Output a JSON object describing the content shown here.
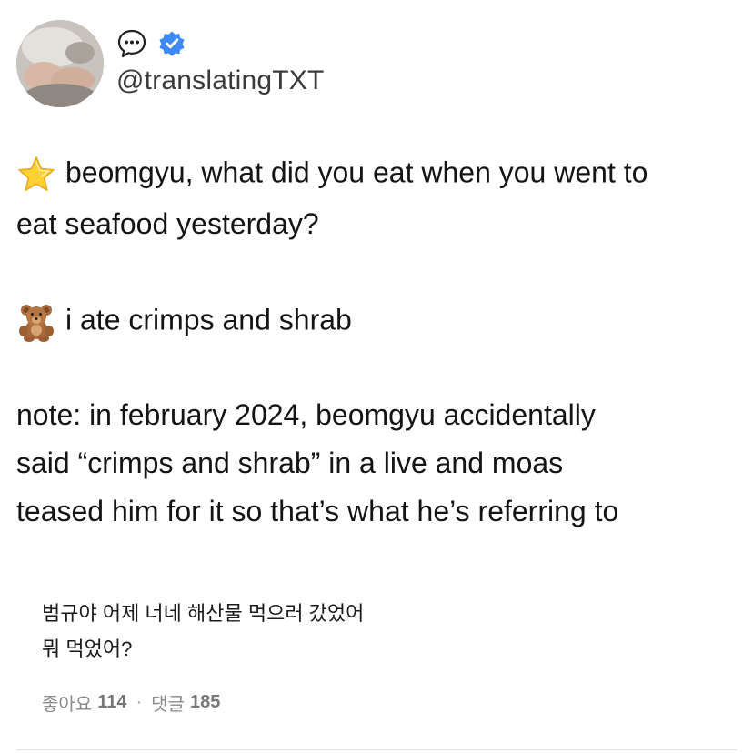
{
  "profile": {
    "handle": "@translatingTXT",
    "verified_color": "#3d8af7"
  },
  "tweet": {
    "q_line1": "beomgyu, what did you eat when you went to",
    "q_line2": "eat seafood yesterday?",
    "a_line": "i ate crimps and shrab",
    "note_line1": "note: in february 2024, beomgyu accidentally",
    "note_line2": "said “crimps and shrab” in a live and moas",
    "note_line3": "teased him for it so that’s what he’s referring to",
    "star_icon": "star-emoji",
    "bear_icon": "teddy-bear-emoji"
  },
  "embedded_post": {
    "line1": "범규야 어제 너네 해산물 먹으러 갔었어",
    "line2": "뭐 먹었어?",
    "likes_label": "좋아요",
    "likes_count": "114",
    "separator": "·",
    "comments_label": "댓글",
    "comments_count": "185"
  }
}
